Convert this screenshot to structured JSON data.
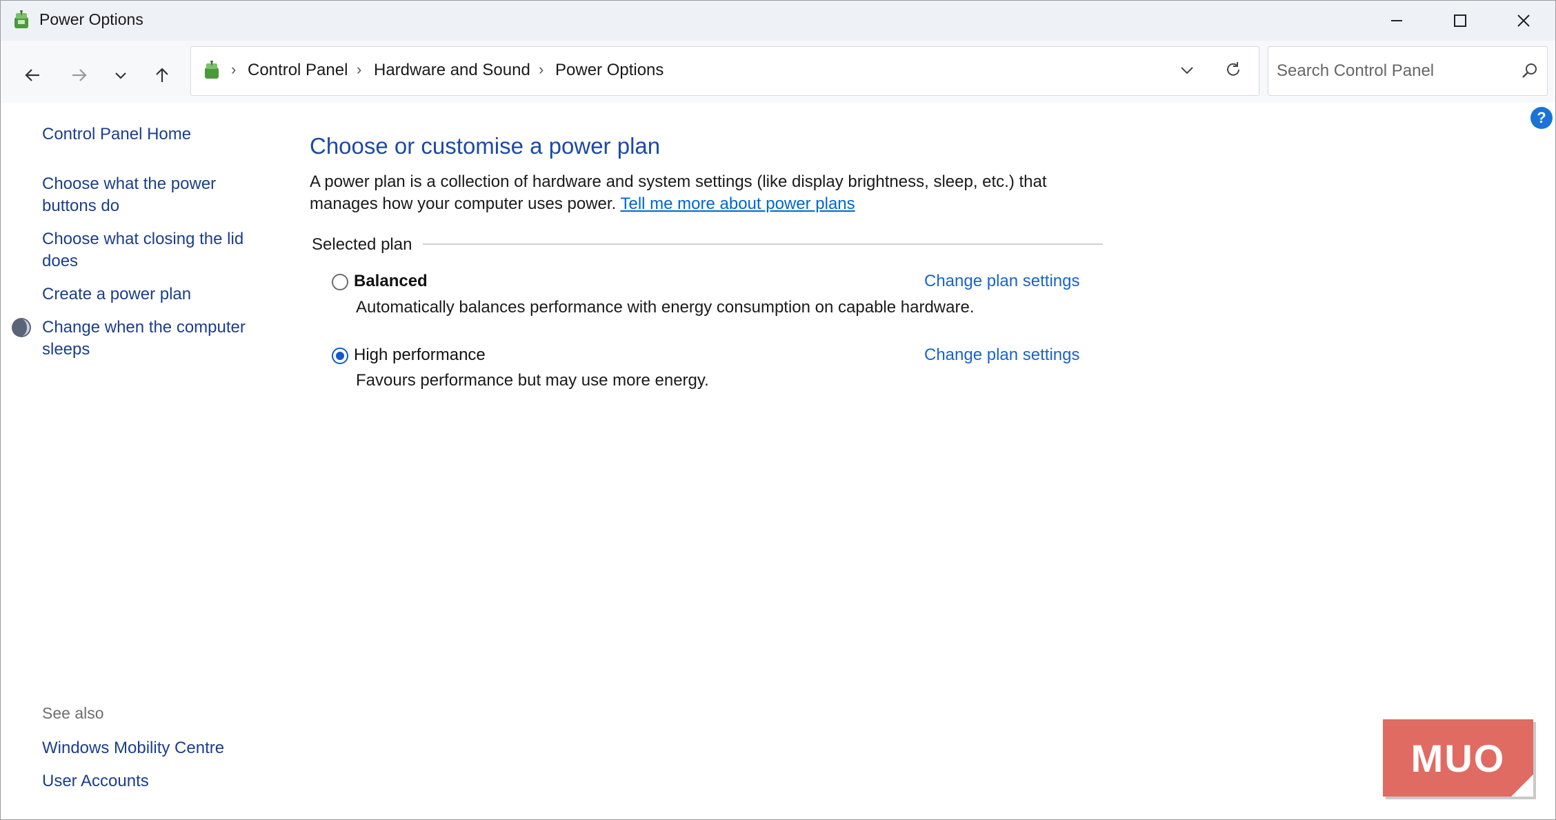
{
  "window": {
    "title": "Power Options"
  },
  "breadcrumb": [
    "Control Panel",
    "Hardware and Sound",
    "Power Options"
  ],
  "search": {
    "placeholder": "Search Control Panel"
  },
  "sidebar": {
    "home": "Control Panel Home",
    "links": [
      "Choose what the power buttons do",
      "Choose what closing the lid does",
      "Create a power plan",
      "Change when the computer sleeps"
    ],
    "see_also_label": "See also",
    "see_also": [
      "Windows Mobility Centre",
      "User Accounts"
    ]
  },
  "main": {
    "title": "Choose or customise a power plan",
    "description": "A power plan is a collection of hardware and system settings (like display brightness, sleep, etc.) that manages how your computer uses power.",
    "learn_more_link": "Tell me more about power plans",
    "section_label": "Selected plan",
    "plans": [
      {
        "name": "Balanced",
        "description": "Automatically balances performance with energy consumption on capable hardware.",
        "selected": false,
        "link": "Change plan settings"
      },
      {
        "name": "High performance",
        "description": "Favours performance but may use more energy.",
        "selected": true,
        "link": "Change plan settings"
      }
    ]
  },
  "watermark": {
    "text": "MUO"
  },
  "colors": {
    "link": "#1b3e8c",
    "heading": "#1c4aa5",
    "accent": "#1458c7",
    "watermark": "#e06b62"
  },
  "icons": [
    "power-options-icon",
    "back-arrow-icon",
    "forward-arrow-icon",
    "chevron-down-icon",
    "up-arrow-icon",
    "refresh-icon",
    "search-icon",
    "help-icon",
    "shield-icon"
  ]
}
